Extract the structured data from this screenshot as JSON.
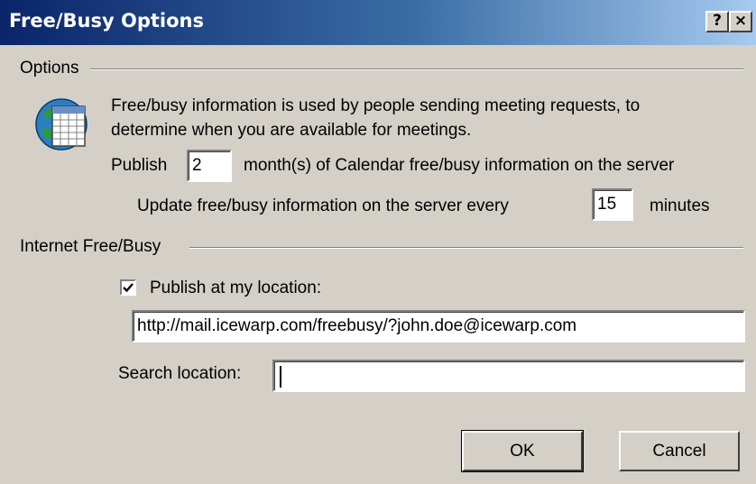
{
  "window": {
    "title": "Free/Busy Options",
    "help_glyph": "?",
    "close_glyph": "×"
  },
  "options_group": {
    "label": "Options",
    "icon": "calendar-icon",
    "description_line1": "Free/busy information is used by people sending meeting requests, to",
    "description_line2": "determine when you are available for meetings.",
    "publish_prefix": "Publish",
    "publish_months_value": "2",
    "publish_suffix": "month(s) of Calendar free/busy information on the server",
    "update_prefix": "Update free/busy information on the server every",
    "update_minutes_value": "15",
    "update_suffix": "minutes"
  },
  "internet_group": {
    "label": "Internet Free/Busy",
    "publish_checkbox_checked": true,
    "publish_checkbox_label": "Publish at my location:",
    "publish_url_value": "http://mail.icewarp.com/freebusy/?john.doe@icewarp.com",
    "search_location_label": "Search location:",
    "search_location_value": ""
  },
  "buttons": {
    "ok_label": "OK",
    "cancel_label": "Cancel"
  },
  "colors": {
    "titlebar_start": "#0a246a",
    "titlebar_end": "#a6caf0",
    "dialog_face": "#d4d0c8"
  }
}
